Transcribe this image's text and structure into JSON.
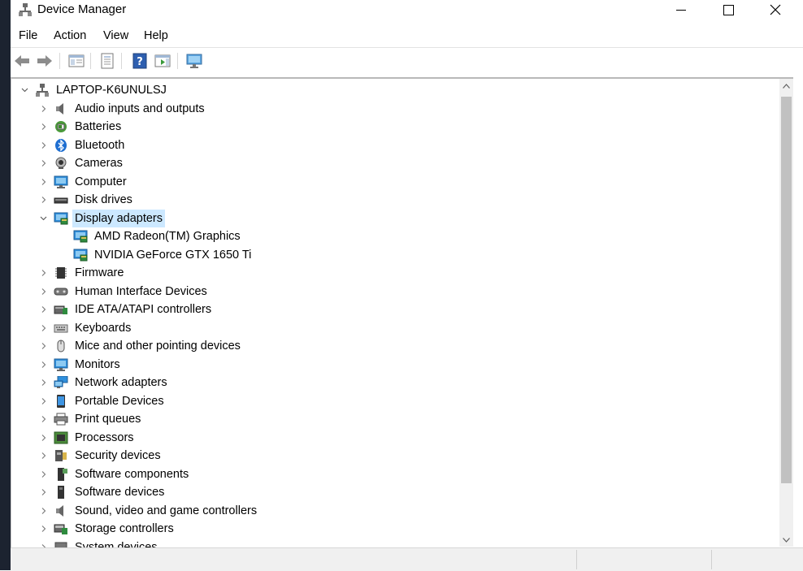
{
  "window": {
    "title": "Device Manager",
    "app_icon": "device-manager-icon"
  },
  "menu": {
    "items": [
      {
        "label": "File"
      },
      {
        "label": "Action"
      },
      {
        "label": "View"
      },
      {
        "label": "Help"
      }
    ]
  },
  "toolbar": {
    "buttons": [
      {
        "icon": "back-arrow-icon"
      },
      {
        "icon": "forward-arrow-icon"
      },
      {
        "icon": "show-hide-console-tree-icon"
      },
      {
        "icon": "properties-icon"
      },
      {
        "icon": "help-icon"
      },
      {
        "icon": "action-pane-icon"
      },
      {
        "icon": "scan-hardware-icon"
      }
    ]
  },
  "tree": {
    "root": "LAPTOP-K6UNULSJ",
    "categories": [
      {
        "label": "Audio inputs and outputs",
        "icon": "speaker-icon"
      },
      {
        "label": "Batteries",
        "icon": "battery-icon"
      },
      {
        "label": "Bluetooth",
        "icon": "bluetooth-icon"
      },
      {
        "label": "Cameras",
        "icon": "camera-icon"
      },
      {
        "label": "Computer",
        "icon": "computer-icon"
      },
      {
        "label": "Disk drives",
        "icon": "disk-drive-icon"
      },
      {
        "label": "Display adapters",
        "icon": "display-adapter-icon",
        "expanded": true,
        "selected": true,
        "children": [
          {
            "label": "AMD Radeon(TM) Graphics",
            "icon": "display-adapter-icon"
          },
          {
            "label": "NVIDIA GeForce GTX 1650 Ti",
            "icon": "display-adapter-icon"
          }
        ]
      },
      {
        "label": "Firmware",
        "icon": "firmware-chip-icon"
      },
      {
        "label": "Human Interface Devices",
        "icon": "hid-icon"
      },
      {
        "label": "IDE ATA/ATAPI controllers",
        "icon": "ide-controller-icon"
      },
      {
        "label": "Keyboards",
        "icon": "keyboard-icon"
      },
      {
        "label": "Mice and other pointing devices",
        "icon": "mouse-icon"
      },
      {
        "label": "Monitors",
        "icon": "monitor-icon"
      },
      {
        "label": "Network adapters",
        "icon": "network-adapter-icon"
      },
      {
        "label": "Portable Devices",
        "icon": "portable-device-icon"
      },
      {
        "label": "Print queues",
        "icon": "printer-icon"
      },
      {
        "label": "Processors",
        "icon": "processor-icon"
      },
      {
        "label": "Security devices",
        "icon": "security-device-icon"
      },
      {
        "label": "Software components",
        "icon": "software-component-icon"
      },
      {
        "label": "Software devices",
        "icon": "software-device-icon"
      },
      {
        "label": "Sound, video and game controllers",
        "icon": "sound-controller-icon"
      },
      {
        "label": "Storage controllers",
        "icon": "storage-controller-icon"
      },
      {
        "label": "System devices",
        "icon": "system-device-icon"
      }
    ]
  },
  "colors": {
    "selection": "#cce8ff",
    "desktop": "#1c2330"
  }
}
